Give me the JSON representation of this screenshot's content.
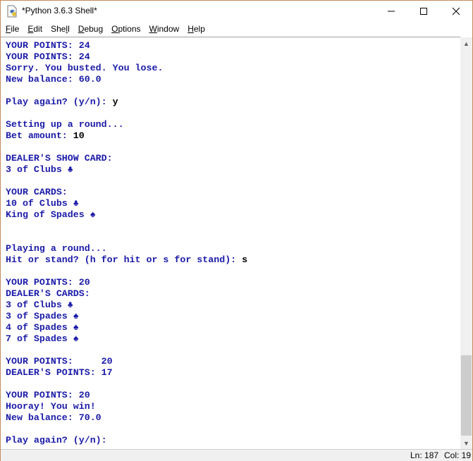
{
  "window": {
    "title": "*Python 3.6.3 Shell*"
  },
  "menu": [
    {
      "label": "File",
      "u": "F",
      "rest": "ile"
    },
    {
      "label": "Edit",
      "u": "E",
      "rest": "dit"
    },
    {
      "label": "Shell",
      "pre": "She",
      "u": "l",
      "rest": "l"
    },
    {
      "label": "Debug",
      "u": "D",
      "rest": "ebug"
    },
    {
      "label": "Options",
      "u": "O",
      "rest": "ptions"
    },
    {
      "label": "Window",
      "u": "W",
      "rest": "indow"
    },
    {
      "label": "Help",
      "u": "H",
      "rest": "elp"
    }
  ],
  "shell_lines": [
    {
      "out": "YOUR POINTS: 24"
    },
    {
      "out": "YOUR POINTS: 24"
    },
    {
      "out": "Sorry. You busted. You lose."
    },
    {
      "out": "New balance: 60.0"
    },
    {
      "out": ""
    },
    {
      "out": "Play again? (y/n): ",
      "in": "y"
    },
    {
      "out": ""
    },
    {
      "out": "Setting up a round..."
    },
    {
      "out": "Bet amount: ",
      "in": "10"
    },
    {
      "out": ""
    },
    {
      "out": "DEALER'S SHOW CARD:"
    },
    {
      "out": "3 of Clubs ♣"
    },
    {
      "out": ""
    },
    {
      "out": "YOUR CARDS:"
    },
    {
      "out": "10 of Clubs ♣"
    },
    {
      "out": "King of Spades ♠"
    },
    {
      "out": ""
    },
    {
      "out": ""
    },
    {
      "out": "Playing a round..."
    },
    {
      "out": "Hit or stand? (h for hit or s for stand): ",
      "in": "s"
    },
    {
      "out": ""
    },
    {
      "out": "YOUR POINTS: 20"
    },
    {
      "out": "DEALER'S CARDS:"
    },
    {
      "out": "3 of Clubs ♣"
    },
    {
      "out": "3 of Spades ♠"
    },
    {
      "out": "4 of Spades ♠"
    },
    {
      "out": "7 of Spades ♠"
    },
    {
      "out": ""
    },
    {
      "out": "YOUR POINTS:     20"
    },
    {
      "out": "DEALER'S POINTS: 17"
    },
    {
      "out": ""
    },
    {
      "out": "YOUR POINTS: 20"
    },
    {
      "out": "Hooray! You win!"
    },
    {
      "out": "New balance: 70.0"
    },
    {
      "out": ""
    },
    {
      "out": "Play again? (y/n): "
    }
  ],
  "status": {
    "line": "Ln: 187",
    "col": "Col: 19"
  },
  "colors": {
    "output": "#1a1aa8",
    "input": "#000000",
    "border": "#c58b5c"
  }
}
